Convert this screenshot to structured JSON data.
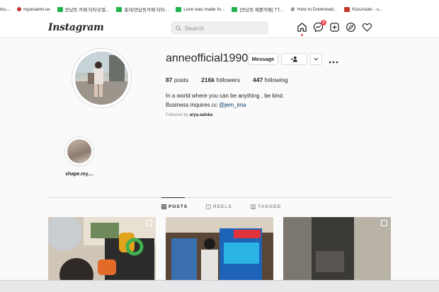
{
  "bookmarks": [
    {
      "label": "tcu...",
      "color": "#ffffff"
    },
    {
      "label": "myasiantv.se",
      "color": "#c0392b"
    },
    {
      "label": "연남동 카페 티타유엘...",
      "color": "#1fb34a"
    },
    {
      "label": "홍대/연남동카페 티타...",
      "color": "#1fb34a"
    },
    {
      "label": "Love was made fo...",
      "color": "#1fb34a"
    },
    {
      "label": "[연남동 예쁜카페] TT...",
      "color": "#1fb34a"
    },
    {
      "label": "How to Download...",
      "color": "#333333"
    },
    {
      "label": "KissAsian - v...",
      "color": "#c0392b"
    }
  ],
  "nav": {
    "logo": "Instagram",
    "search_placeholder": "Search",
    "notification_count": "1"
  },
  "profile": {
    "username": "anneofficial1990",
    "message_button": "Message",
    "posts_count": "87",
    "posts_label": "posts",
    "followers_count": "216k",
    "followers_label": "followers",
    "following_count": "447",
    "following_label": "following",
    "bio_line1": "In a world where you can be anything , be kind.",
    "bio_line2_prefix": "Business inquires cc ",
    "bio_mention": "@jem_ima",
    "followed_by_prefix": "Followed by ",
    "followed_by_user": "arya.saloka"
  },
  "highlights": [
    {
      "label": "shape.my...."
    }
  ],
  "tabs": [
    {
      "label": "POSTS",
      "active": true
    },
    {
      "label": "REELS",
      "active": false
    },
    {
      "label": "TAGGED",
      "active": false
    }
  ],
  "colors": {
    "accent_red": "#ed4956",
    "mention_blue": "#00376b",
    "text": "#262626",
    "muted": "#8e8e8e"
  }
}
